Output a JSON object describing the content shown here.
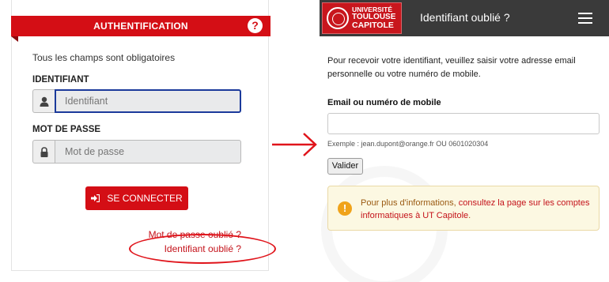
{
  "login": {
    "header_title": "AUTHENTIFICATION",
    "help_icon": "?",
    "required_note": "Tous les champs sont obligatoires",
    "identifier_label": "IDENTIFIANT",
    "identifier_placeholder": "Identifiant",
    "password_label": "MOT DE PASSE",
    "password_placeholder": "Mot de passe",
    "login_button": "SE CONNECTER",
    "forgot_password_link": "Mot de passe oublié ?",
    "forgot_identifier_link": "Identifiant oublié ?",
    "icons": {
      "user": "user-icon",
      "lock": "lock-icon",
      "login": "sign-in-icon"
    }
  },
  "recovery": {
    "logo": [
      "UNIVERSITÉ",
      "TOULOUSE",
      "CAPITOLE"
    ],
    "nav_title": "Identifiant oublié ?",
    "intro": "Pour recevoir votre identifiant, veuillez saisir votre adresse email personnelle ou votre numéro de mobile.",
    "email_label": "Email ou numéro de mobile",
    "email_value": "",
    "example": "Exemple : jean.dupont@orange.fr OU 0601020304",
    "submit_button": "Valider",
    "info_prefix": "Pour plus d'informations, ",
    "info_link": "consultez la page sur les comptes informatiques à UT Capitole",
    "info_suffix": "."
  },
  "colors": {
    "brand_red": "#d40e15",
    "focus_blue": "#1b3a9b",
    "navbar": "#3a3a3a",
    "warning_bg": "#fcf8e2",
    "warning_icon": "#f0a31a"
  }
}
